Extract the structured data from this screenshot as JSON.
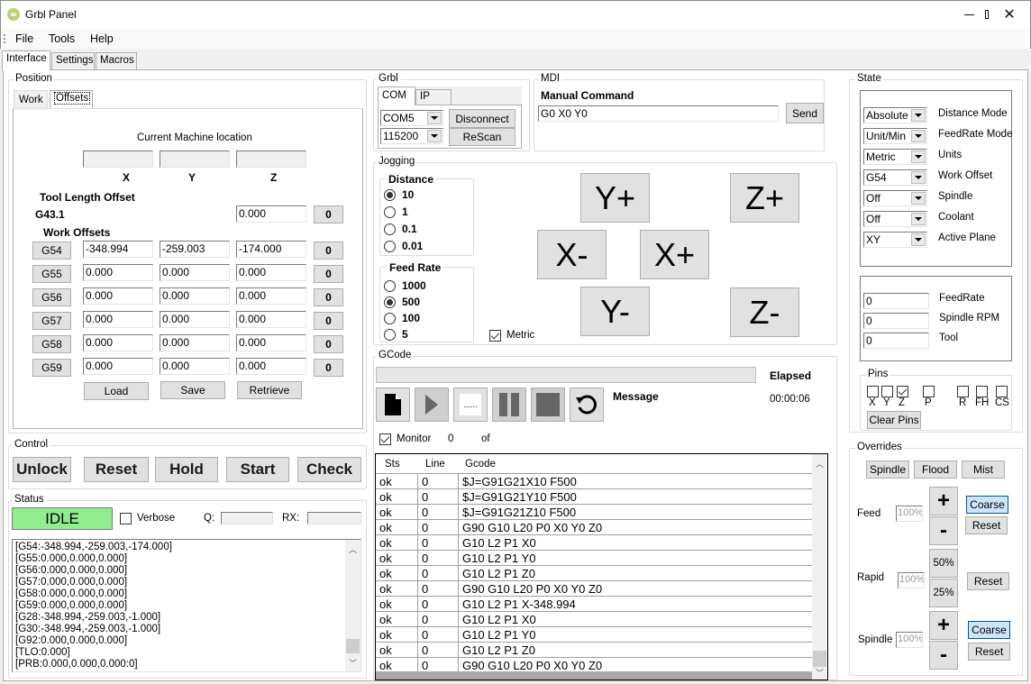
{
  "window": {
    "title": "Grbl Panel",
    "controls": [
      "minimize",
      "maximize",
      "close"
    ]
  },
  "menu": [
    "File",
    "Tools",
    "Help"
  ],
  "main_tabs": [
    {
      "label": "Interface",
      "active": true
    },
    {
      "label": "Settings",
      "active": false
    },
    {
      "label": "Macros",
      "active": false
    }
  ],
  "position": {
    "group_label": "Position",
    "tabs": [
      {
        "label": "Work",
        "active": false
      },
      {
        "label": "Offsets",
        "active": true
      }
    ],
    "machine_location_label": "Current Machine location",
    "machine_location": {
      "x": "",
      "y": "",
      "z": ""
    },
    "axis_labels": [
      "X",
      "Y",
      "Z"
    ],
    "tlo_label": "Tool Length Offset",
    "tlo_code": "G43.1",
    "tlo_value": "0.000",
    "zero_label": "0",
    "work_offsets_label": "Work Offsets",
    "offsets": [
      {
        "code": "G54",
        "x": "-348.994",
        "y": "-259.003",
        "z": "-174.000"
      },
      {
        "code": "G55",
        "x": "0.000",
        "y": "0.000",
        "z": "0.000"
      },
      {
        "code": "G56",
        "x": "0.000",
        "y": "0.000",
        "z": "0.000"
      },
      {
        "code": "G57",
        "x": "0.000",
        "y": "0.000",
        "z": "0.000"
      },
      {
        "code": "G58",
        "x": "0.000",
        "y": "0.000",
        "z": "0.000"
      },
      {
        "code": "G59",
        "x": "0.000",
        "y": "0.000",
        "z": "0.000"
      }
    ],
    "buttons": {
      "load": "Load",
      "save": "Save",
      "retrieve": "Retrieve"
    }
  },
  "control": {
    "group_label": "Control",
    "buttons": [
      "Unlock",
      "Reset",
      "Hold",
      "Start",
      "Check"
    ]
  },
  "status": {
    "group_label": "Status",
    "state": "IDLE",
    "state_color": "#90ee90",
    "verbose_label": "Verbose",
    "verbose_checked": false,
    "q_label": "Q:",
    "q_value": "",
    "rx_label": "RX:",
    "rx_value": "",
    "log": [
      "[G54:-348.994,-259.003,-174.000]",
      "[G55:0.000,0.000,0.000]",
      "[G56:0.000,0.000,0.000]",
      "[G57:0.000,0.000,0.000]",
      "[G58:0.000,0.000,0.000]",
      "[G59:0.000,0.000,0.000]",
      "[G28:-348.994,-259.003,-1.000]",
      "[G30:-348.994,-259.003,-1.000]",
      "[G92:0.000,0.000,0.000]",
      "[TLO:0.000]",
      "[PRB:0.000,0.000,0.000:0]"
    ]
  },
  "grbl": {
    "group_label": "Grbl",
    "tabs": [
      {
        "label": "COM",
        "active": true
      },
      {
        "label": "IP",
        "active": false
      }
    ],
    "port": "COM5",
    "baud": "115200",
    "disconnect_label": "Disconnect",
    "rescan_label": "ReScan"
  },
  "mdi": {
    "group_label": "MDI",
    "label": "Manual Command",
    "value": "G0 X0 Y0",
    "send_label": "Send"
  },
  "jogging": {
    "group_label": "Jogging",
    "distance_label": "Distance",
    "distances": [
      {
        "label": "10",
        "selected": true
      },
      {
        "label": "1",
        "selected": false
      },
      {
        "label": "0.1",
        "selected": false
      },
      {
        "label": "0.01",
        "selected": false
      }
    ],
    "feed_label": "Feed Rate",
    "feeds": [
      {
        "label": "1000",
        "selected": false
      },
      {
        "label": "500",
        "selected": true
      },
      {
        "label": "100",
        "selected": false
      },
      {
        "label": "5",
        "selected": false
      }
    ],
    "metric_label": "Metric",
    "metric_checked": true,
    "buttons": {
      "y_plus": "Y+",
      "y_minus": "Y-",
      "x_plus": "X+",
      "x_minus": "X-",
      "z_plus": "Z+",
      "z_minus": "Z-"
    }
  },
  "gcode": {
    "group_label": "GCode",
    "progress": 0,
    "elapsed_label": "Elapsed",
    "elapsed": "00:00:06",
    "message_label": "Message",
    "toolbar_icons": [
      "file-icon",
      "play-icon",
      "step-icon",
      "pause-icon",
      "stop-icon",
      "reload-icon"
    ],
    "monitor_label": "Monitor",
    "monitor_checked": true,
    "line_count": "0",
    "of_label": "of",
    "columns": [
      "Sts",
      "Line",
      "Gcode"
    ],
    "rows": [
      {
        "sts": "ok",
        "line": "0",
        "gcode": "$J=G91G21X10 F500"
      },
      {
        "sts": "ok",
        "line": "0",
        "gcode": "$J=G91G21Y10 F500"
      },
      {
        "sts": "ok",
        "line": "0",
        "gcode": "$J=G91G21Z10 F500"
      },
      {
        "sts": "ok",
        "line": "0",
        "gcode": "G90 G10 L20 P0 X0 Y0 Z0"
      },
      {
        "sts": "ok",
        "line": "0",
        "gcode": "G10 L2 P1 X0"
      },
      {
        "sts": "ok",
        "line": "0",
        "gcode": "G10 L2 P1 Y0"
      },
      {
        "sts": "ok",
        "line": "0",
        "gcode": "G10 L2 P1 Z0"
      },
      {
        "sts": "ok",
        "line": "0",
        "gcode": "G90 G10 L20 P0 X0 Y0 Z0"
      },
      {
        "sts": "ok",
        "line": "0",
        "gcode": "G10 L2 P1 X-348.994"
      },
      {
        "sts": "ok",
        "line": "0",
        "gcode": "G10 L2 P1 X0"
      },
      {
        "sts": "ok",
        "line": "0",
        "gcode": "G10 L2 P1 Y0"
      },
      {
        "sts": "ok",
        "line": "0",
        "gcode": "G10 L2 P1 Z0"
      },
      {
        "sts": "ok",
        "line": "0",
        "gcode": "G90 G10 L20 P0 X0 Y0 Z0"
      }
    ]
  },
  "state": {
    "group_label": "State",
    "modes": [
      {
        "value": "Absolute",
        "label": "Distance Mode"
      },
      {
        "value": "Unit/Min",
        "label": "FeedRate Mode"
      },
      {
        "value": "Metric",
        "label": "Units"
      },
      {
        "value": "G54",
        "label": "Work Offset"
      },
      {
        "value": "Off",
        "label": "Spindle"
      },
      {
        "value": "Off",
        "label": "Coolant"
      },
      {
        "value": "XY",
        "label": "Active Plane"
      }
    ],
    "values": [
      {
        "value": "0",
        "label": "FeedRate"
      },
      {
        "value": "0",
        "label": "Spindle RPM"
      },
      {
        "value": "0",
        "label": "Tool"
      }
    ]
  },
  "pins": {
    "group_label": "Pins",
    "pins": [
      {
        "label": "X",
        "checked": false
      },
      {
        "label": "Y",
        "checked": false
      },
      {
        "label": "Z",
        "checked": true
      },
      {
        "label": "P",
        "checked": false
      },
      {
        "label": "R",
        "checked": false
      },
      {
        "label": "FH",
        "checked": false
      },
      {
        "label": "CS",
        "checked": false
      }
    ],
    "clear_label": "Clear Pins"
  },
  "overrides": {
    "group_label": "Overrides",
    "toggles": [
      "Spindle",
      "Flood",
      "Mist"
    ],
    "feed": {
      "label": "Feed",
      "value": "100%",
      "plus": "+",
      "minus": "-",
      "coarse": "Coarse",
      "reset": "Reset"
    },
    "rapid": {
      "label": "Rapid",
      "value": "100%",
      "fifty": "50%",
      "twentyfive": "25%",
      "reset": "Reset"
    },
    "spindle": {
      "label": "Spindle",
      "value": "100%",
      "plus": "+",
      "minus": "-",
      "coarse": "Coarse",
      "reset": "Reset"
    }
  }
}
